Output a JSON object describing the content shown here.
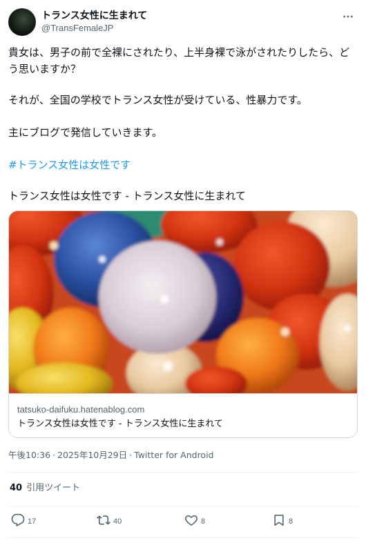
{
  "author": {
    "display_name": "トランス女性に生まれて",
    "handle": "@TransFemaleJP",
    "avatar_icon": "avatar"
  },
  "more_icon": "more-dots-icon",
  "post": {
    "paragraph1": "貴女は、男子の前で全裸にされたり、上半身裸で泳がされたりしたら、どう思いますか？",
    "paragraph2": "それが、全国の学校でトランス女性が受けている、性暴力です。",
    "paragraph3": "主にブログで発信していきます。",
    "hashtag": "#トランス女性は女性です",
    "paragraph5": "トランス女性は女性です - トランス女性に生まれて"
  },
  "link_card": {
    "domain": "tatsuko-daifuku.hatenablog.com",
    "title": "トランス女性は女性です - トランス女性に生まれて"
  },
  "meta": {
    "time": "午後10:36",
    "date": "2025年10月29日",
    "source": "Twitter for Android",
    "separator": "·"
  },
  "quotes": {
    "count": "40",
    "label": "引用ツイート"
  },
  "actions": {
    "reply": {
      "icon": "reply-icon",
      "count": "17"
    },
    "retweet": {
      "icon": "retweet-icon",
      "count": "40"
    },
    "like": {
      "icon": "heart-icon",
      "count": "8"
    },
    "bookmark": {
      "icon": "bookmark-icon",
      "count": "8"
    }
  },
  "colors": {
    "link": "#1d9bf0",
    "secondary_text": "#536471",
    "border": "#cfd9de"
  }
}
